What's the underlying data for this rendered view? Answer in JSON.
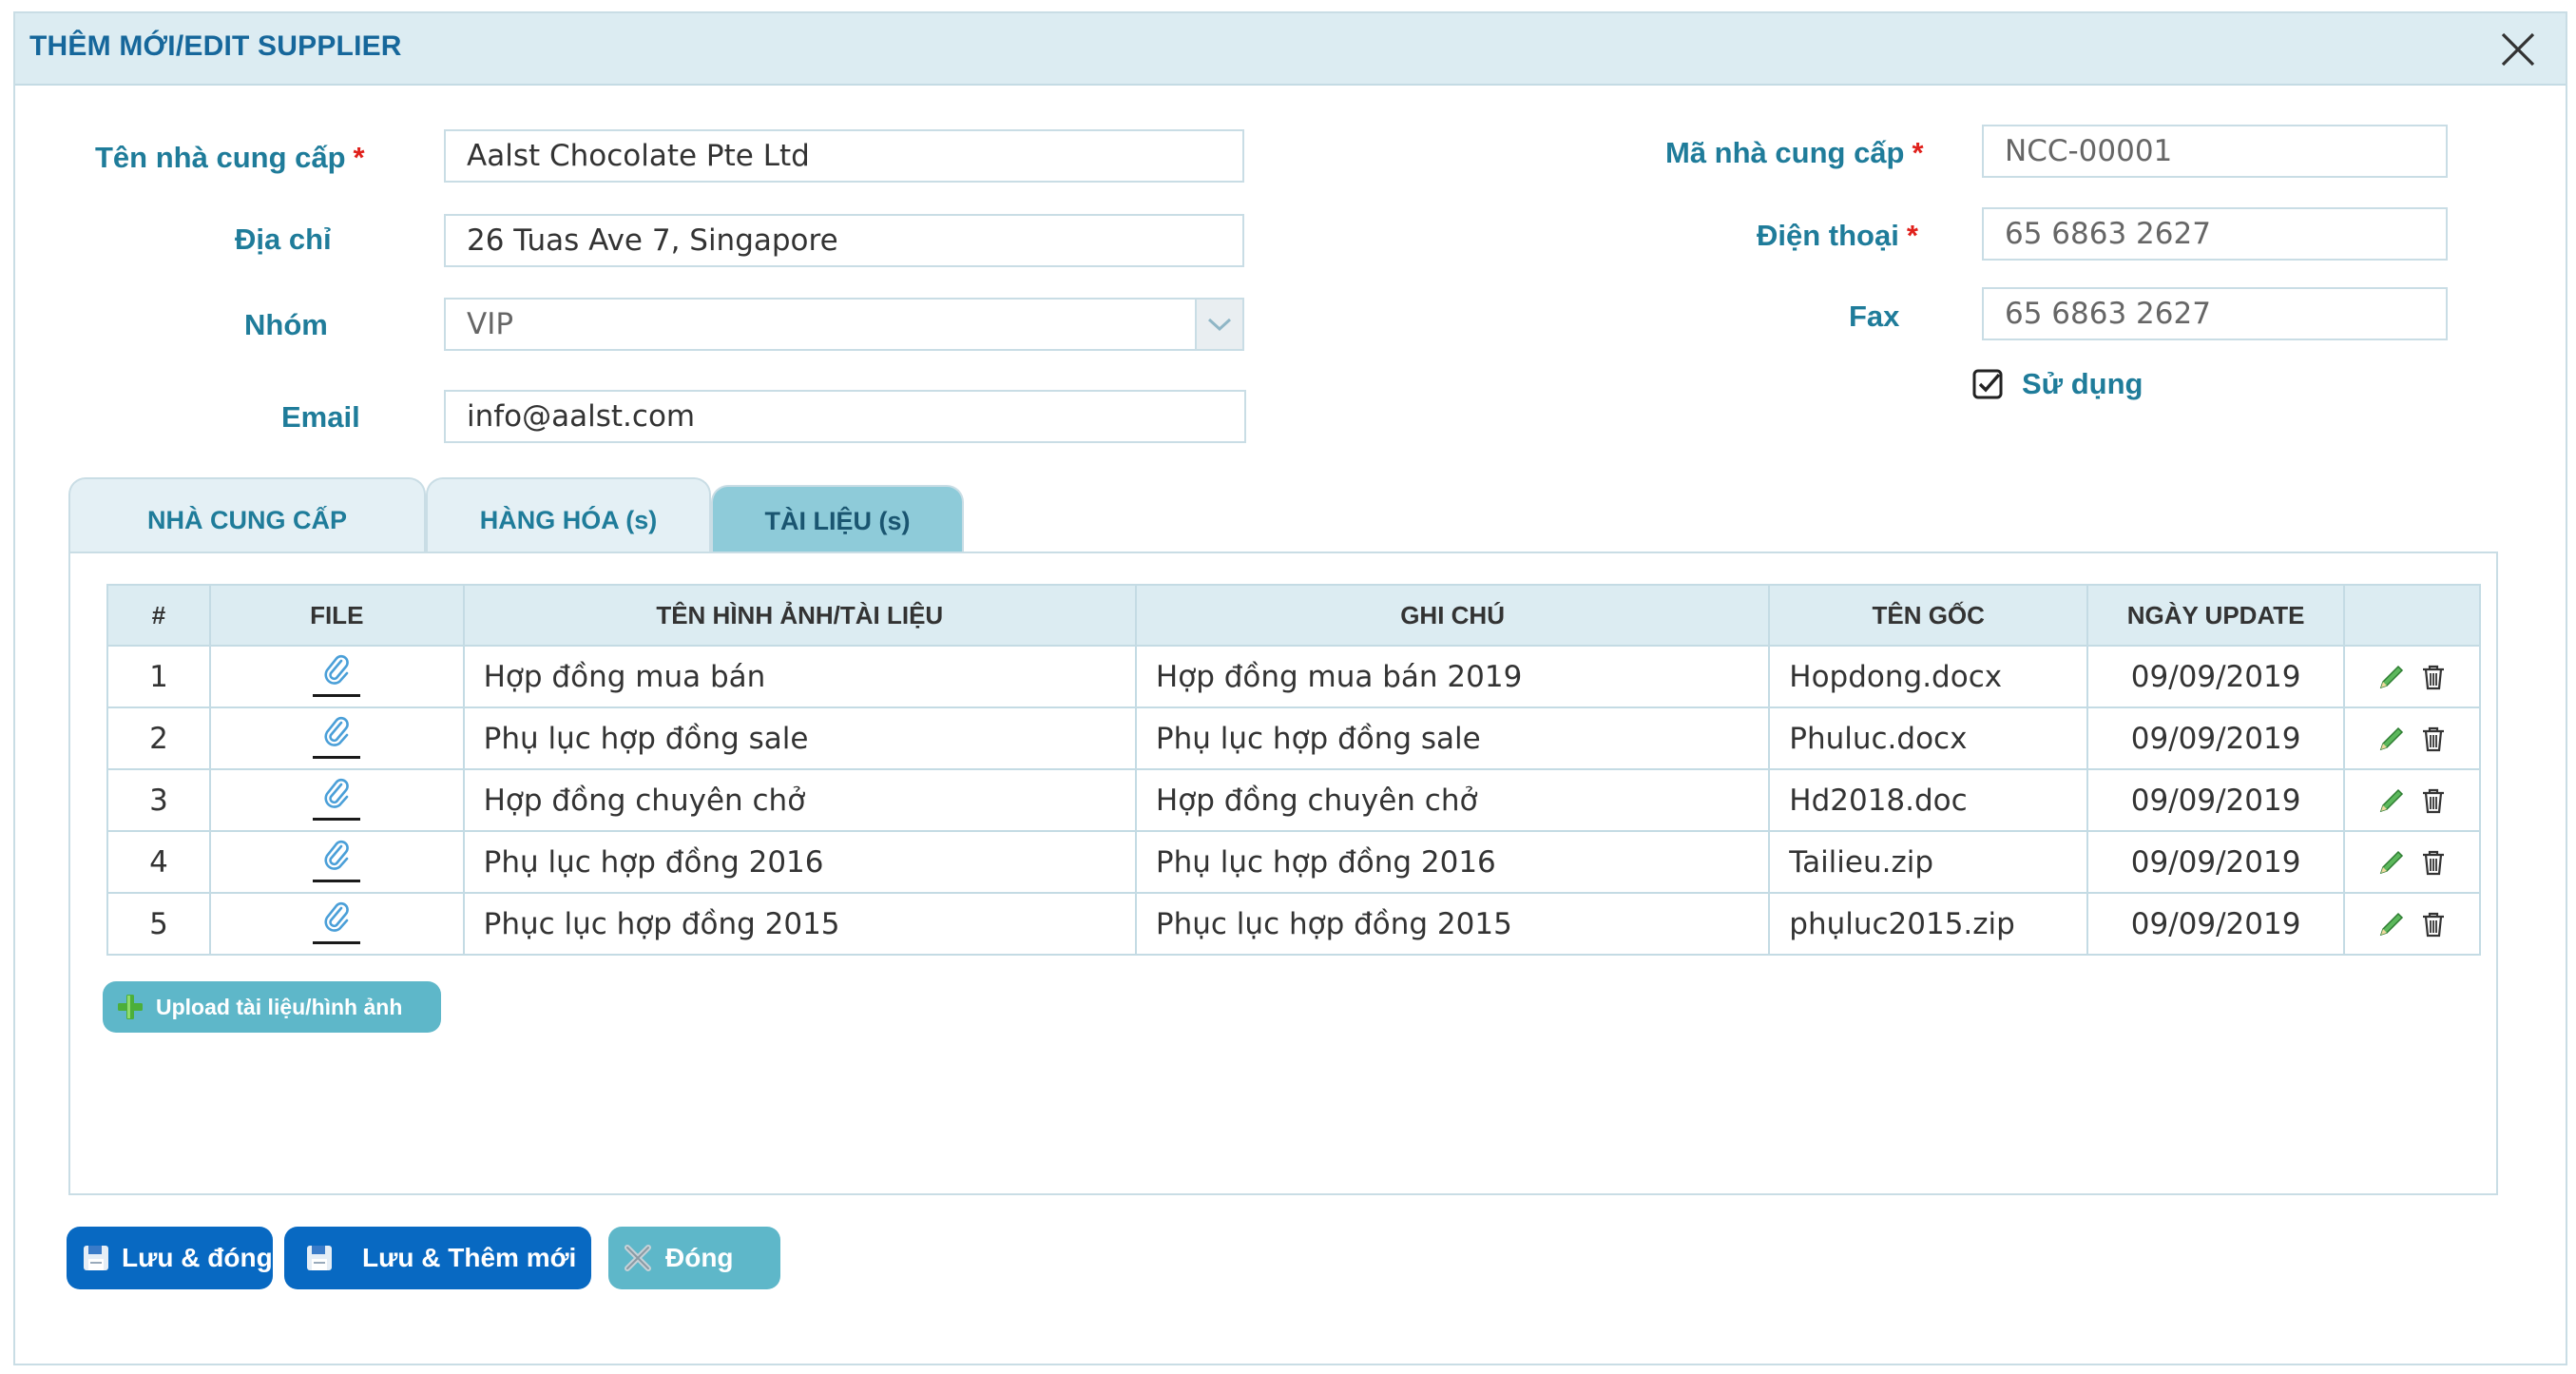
{
  "dialog": {
    "title": "THÊM MỚI/EDIT SUPPLIER"
  },
  "form": {
    "supplier_name": {
      "label": "Tên nhà cung cấp",
      "required": "*",
      "value": "Aalst Chocolate Pte Ltd"
    },
    "address": {
      "label": "Địa chỉ",
      "value": "26 Tuas Ave 7, Singapore"
    },
    "group": {
      "label": "Nhóm",
      "value": "VIP"
    },
    "email": {
      "label": "Email",
      "value": "info@aalst.com"
    },
    "supplier_code": {
      "label": "Mã nhà cung cấp",
      "required": "*",
      "value": "NCC-00001"
    },
    "phone": {
      "label": "Điện thoại",
      "required": "*",
      "value": "65 6863 2627"
    },
    "fax": {
      "label": "Fax",
      "value": "65 6863 2627"
    },
    "active": {
      "label": "Sử dụng",
      "checked": true
    }
  },
  "tabs": [
    {
      "label": "NHÀ CUNG CẤP",
      "active": false
    },
    {
      "label": "HÀNG HÓA (s)",
      "active": false
    },
    {
      "label": "TÀI LIỆU (s)",
      "active": true
    }
  ],
  "table": {
    "headers": [
      "#",
      "FILE",
      "TÊN HÌNH ẢNH/TÀI LIỆU",
      "GHI CHÚ",
      "TÊN GỐC",
      "NGÀY UPDATE",
      ""
    ],
    "rows": [
      {
        "no": "1",
        "name": "Hợp đồng mua bán",
        "note": "Hợp đồng mua bán 2019",
        "original": "Hopdong.docx",
        "date": "09/09/2019"
      },
      {
        "no": "2",
        "name": "Phụ lục hợp đồng sale",
        "note": "Phụ lục hợp đồng sale",
        "original": "Phuluc.docx",
        "date": "09/09/2019"
      },
      {
        "no": "3",
        "name": "Hợp đồng chuyên chở",
        "note": "Hợp đồng chuyên chở",
        "original": "Hd2018.doc",
        "date": "09/09/2019"
      },
      {
        "no": "4",
        "name": "Phụ lục hợp đồng 2016",
        "note": "Phụ lục hợp đồng 2016",
        "original": "Tailieu.zip",
        "date": "09/09/2019"
      },
      {
        "no": "5",
        "name": "Phục lục hợp đồng 2015",
        "note": "Phục lục hợp đồng 2015",
        "original": "phụluc2015.zip",
        "date": "09/09/2019"
      }
    ]
  },
  "upload_button": "Upload tài liệu/hình ảnh",
  "footer": {
    "save_close": "Lưu & đóng",
    "save_new": "Lưu & Thêm mới",
    "close": "Đóng"
  },
  "colors": {
    "accent": "#1f7c9a",
    "title": "#16679b",
    "primary_button": "#0869c2",
    "secondary_button": "#5eb7c9",
    "header_bg": "#dcecf2",
    "required": "#e0201b"
  },
  "icons": [
    "close-icon",
    "chevron-down-icon",
    "checkbox-checked-icon",
    "paperclip-icon",
    "pencil-icon",
    "trash-icon",
    "plus-icon",
    "floppy-disk-icon",
    "x-icon"
  ]
}
